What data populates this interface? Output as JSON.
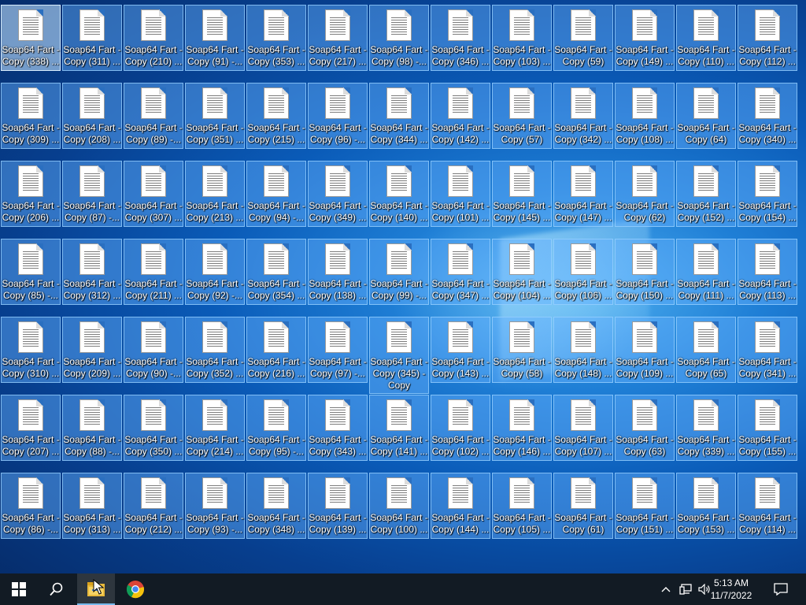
{
  "desktop": {
    "files": [
      {
        "line1": "Soap64 Fart -",
        "line2": "Copy (338) ..."
      },
      {
        "line1": "Soap64 Fart -",
        "line2": "Copy (311) ..."
      },
      {
        "line1": "Soap64 Fart -",
        "line2": "Copy (210) ..."
      },
      {
        "line1": "Soap64 Fart -",
        "line2": "Copy (91) -..."
      },
      {
        "line1": "Soap64 Fart -",
        "line2": "Copy (353) ..."
      },
      {
        "line1": "Soap64 Fart -",
        "line2": "Copy (217) ..."
      },
      {
        "line1": "Soap64 Fart -",
        "line2": "Copy (98) -..."
      },
      {
        "line1": "Soap64 Fart -",
        "line2": "Copy (346) ..."
      },
      {
        "line1": "Soap64 Fart -",
        "line2": "Copy (103) ..."
      },
      {
        "line1": "Soap64 Fart -",
        "line2": "Copy (59)"
      },
      {
        "line1": "Soap64 Fart -",
        "line2": "Copy (149) ..."
      },
      {
        "line1": "Soap64 Fart -",
        "line2": "Copy (110) ..."
      },
      {
        "line1": "Soap64 Fart -",
        "line2": "Copy (112) ..."
      },
      {
        "line1": "Soap64 Fart -",
        "line2": "Copy (309) ..."
      },
      {
        "line1": "Soap64 Fart -",
        "line2": "Copy (208) ..."
      },
      {
        "line1": "Soap64 Fart -",
        "line2": "Copy (89) -..."
      },
      {
        "line1": "Soap64 Fart -",
        "line2": "Copy (351) ..."
      },
      {
        "line1": "Soap64 Fart -",
        "line2": "Copy (215) ..."
      },
      {
        "line1": "Soap64 Fart -",
        "line2": "Copy (96) -..."
      },
      {
        "line1": "Soap64 Fart -",
        "line2": "Copy (344) ..."
      },
      {
        "line1": "Soap64 Fart -",
        "line2": "Copy (142) ..."
      },
      {
        "line1": "Soap64 Fart -",
        "line2": "Copy (57)"
      },
      {
        "line1": "Soap64 Fart -",
        "line2": "Copy (342) ..."
      },
      {
        "line1": "Soap64 Fart -",
        "line2": "Copy (108) ..."
      },
      {
        "line1": "Soap64 Fart -",
        "line2": "Copy (64)"
      },
      {
        "line1": "Soap64 Fart -",
        "line2": "Copy (340) ..."
      },
      {
        "line1": "Soap64 Fart -",
        "line2": "Copy (206) ..."
      },
      {
        "line1": "Soap64 Fart -",
        "line2": "Copy (87) -..."
      },
      {
        "line1": "Soap64 Fart -",
        "line2": "Copy (307) ..."
      },
      {
        "line1": "Soap64 Fart -",
        "line2": "Copy (213) ..."
      },
      {
        "line1": "Soap64 Fart -",
        "line2": "Copy (94) -..."
      },
      {
        "line1": "Soap64 Fart -",
        "line2": "Copy (349) ..."
      },
      {
        "line1": "Soap64 Fart -",
        "line2": "Copy (140) ..."
      },
      {
        "line1": "Soap64 Fart -",
        "line2": "Copy (101) ..."
      },
      {
        "line1": "Soap64 Fart -",
        "line2": "Copy (145) ..."
      },
      {
        "line1": "Soap64 Fart -",
        "line2": "Copy (147) ..."
      },
      {
        "line1": "Soap64 Fart -",
        "line2": "Copy (62)"
      },
      {
        "line1": "Soap64 Fart -",
        "line2": "Copy (152) ..."
      },
      {
        "line1": "Soap64 Fart -",
        "line2": "Copy (154) ..."
      },
      {
        "line1": "Soap64 Fart -",
        "line2": "Copy (85) -..."
      },
      {
        "line1": "Soap64 Fart -",
        "line2": "Copy (312) ..."
      },
      {
        "line1": "Soap64 Fart -",
        "line2": "Copy (211) ..."
      },
      {
        "line1": "Soap64 Fart -",
        "line2": "Copy (92) -..."
      },
      {
        "line1": "Soap64 Fart -",
        "line2": "Copy (354) ..."
      },
      {
        "line1": "Soap64 Fart -",
        "line2": "Copy (138) ..."
      },
      {
        "line1": "Soap64 Fart -",
        "line2": "Copy (99) -..."
      },
      {
        "line1": "Soap64 Fart -",
        "line2": "Copy (347) ..."
      },
      {
        "line1": "Soap64 Fart -",
        "line2": "Copy (104) ..."
      },
      {
        "line1": "Soap64 Fart -",
        "line2": "Copy (106) ..."
      },
      {
        "line1": "Soap64 Fart -",
        "line2": "Copy (150) ..."
      },
      {
        "line1": "Soap64 Fart -",
        "line2": "Copy (111) ..."
      },
      {
        "line1": "Soap64 Fart -",
        "line2": "Copy (113) ..."
      },
      {
        "line1": "Soap64 Fart -",
        "line2": "Copy (310) ..."
      },
      {
        "line1": "Soap64 Fart -",
        "line2": "Copy (209) ..."
      },
      {
        "line1": "Soap64 Fart -",
        "line2": "Copy (90) -..."
      },
      {
        "line1": "Soap64 Fart -",
        "line2": "Copy (352) ..."
      },
      {
        "line1": "Soap64 Fart -",
        "line2": "Copy (216) ..."
      },
      {
        "line1": "Soap64 Fart -",
        "line2": "Copy (97) -..."
      },
      {
        "line1": "Soap64 Fart -",
        "line2": "Copy (345) -\nCopy"
      },
      {
        "line1": "Soap64 Fart -",
        "line2": "Copy (143) ..."
      },
      {
        "line1": "Soap64 Fart -",
        "line2": "Copy (58)"
      },
      {
        "line1": "Soap64 Fart -",
        "line2": "Copy (148) ..."
      },
      {
        "line1": "Soap64 Fart -",
        "line2": "Copy (109) ..."
      },
      {
        "line1": "Soap64 Fart -",
        "line2": "Copy (65)"
      },
      {
        "line1": "Soap64 Fart -",
        "line2": "Copy (341) ..."
      },
      {
        "line1": "Soap64 Fart -",
        "line2": "Copy (207) ..."
      },
      {
        "line1": "Soap64 Fart -",
        "line2": "Copy (88) -..."
      },
      {
        "line1": "Soap64 Fart -",
        "line2": "Copy (350) ..."
      },
      {
        "line1": "Soap64 Fart -",
        "line2": "Copy (214) ..."
      },
      {
        "line1": "Soap64 Fart -",
        "line2": "Copy (95) -..."
      },
      {
        "line1": "Soap64 Fart -",
        "line2": "Copy (343) ..."
      },
      {
        "line1": "Soap64 Fart -",
        "line2": "Copy (141) ..."
      },
      {
        "line1": "Soap64 Fart -",
        "line2": "Copy (102) ..."
      },
      {
        "line1": "Soap64 Fart -",
        "line2": "Copy (146) ..."
      },
      {
        "line1": "Soap64 Fart -",
        "line2": "Copy (107) ..."
      },
      {
        "line1": "Soap64 Fart -",
        "line2": "Copy (63)"
      },
      {
        "line1": "Soap64 Fart -",
        "line2": "Copy (339) ..."
      },
      {
        "line1": "Soap64 Fart -",
        "line2": "Copy (155) ..."
      },
      {
        "line1": "Soap64 Fart -",
        "line2": "Copy (86) -..."
      },
      {
        "line1": "Soap64 Fart -",
        "line2": "Copy (313) ..."
      },
      {
        "line1": "Soap64 Fart -",
        "line2": "Copy (212) ..."
      },
      {
        "line1": "Soap64 Fart -",
        "line2": "Copy (93) -..."
      },
      {
        "line1": "Soap64 Fart -",
        "line2": "Copy (348) ..."
      },
      {
        "line1": "Soap64 Fart -",
        "line2": "Copy (139) ..."
      },
      {
        "line1": "Soap64 Fart -",
        "line2": "Copy (100) ..."
      },
      {
        "line1": "Soap64 Fart -",
        "line2": "Copy (144) ..."
      },
      {
        "line1": "Soap64 Fart -",
        "line2": "Copy (105) ..."
      },
      {
        "line1": "Soap64 Fart -",
        "line2": "Copy (61)"
      },
      {
        "line1": "Soap64 Fart -",
        "line2": "Copy (151) ..."
      },
      {
        "line1": "Soap64 Fart -",
        "line2": "Copy (153) ..."
      },
      {
        "line1": "Soap64 Fart -",
        "line2": "Copy (114) ..."
      }
    ],
    "focused_index": 0,
    "expanded_index": 58
  },
  "taskbar": {
    "start_icon": "windows-logo-icon",
    "search_icon": "search-icon",
    "pinned": [
      {
        "name": "file-explorer-icon",
        "active": true
      },
      {
        "name": "chrome-icon",
        "active": false
      }
    ],
    "tray_icons": [
      "chevron-up-icon",
      "network-icon",
      "volume-icon"
    ],
    "time": "5:13 AM",
    "date": "11/7/2022",
    "notification_icon": "action-center-icon"
  },
  "colors": {
    "taskbar_bg": "#121b24",
    "icon_selection_bg": "#66b2ff",
    "icon_selection_border": "#99d1ff",
    "desktop_accent": "#0a5bb8"
  }
}
